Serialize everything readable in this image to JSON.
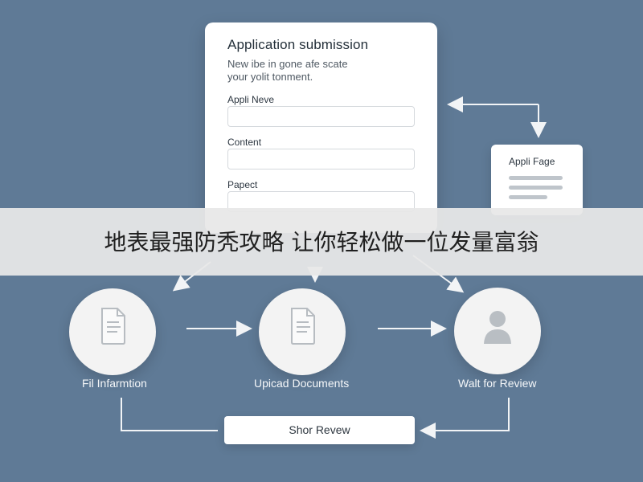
{
  "form": {
    "title": "Application submission",
    "subtitle": "New ibe in gone afe scate\nyour yolit tonment.",
    "fields": [
      {
        "label": "Appli Neve",
        "value": ""
      },
      {
        "label": "Content",
        "value": ""
      },
      {
        "label": "Papect",
        "value": ""
      }
    ]
  },
  "side_card": {
    "title": "Appli Fage"
  },
  "banner": {
    "text": "地表最强防秃攻略 让你轻松做一位发量富翁"
  },
  "steps": [
    {
      "label": "Fil Infarmtion",
      "icon": "document-icon"
    },
    {
      "label": "Upicad Documents",
      "icon": "document-icon"
    },
    {
      "label": "Walt for Review",
      "icon": "user-icon"
    }
  ],
  "review_button": {
    "label": "Shor Revew"
  },
  "colors": {
    "background": "#5f7a96",
    "card": "#ffffff",
    "arrow": "#f2f4f6",
    "circle": "#f3f3f3"
  }
}
